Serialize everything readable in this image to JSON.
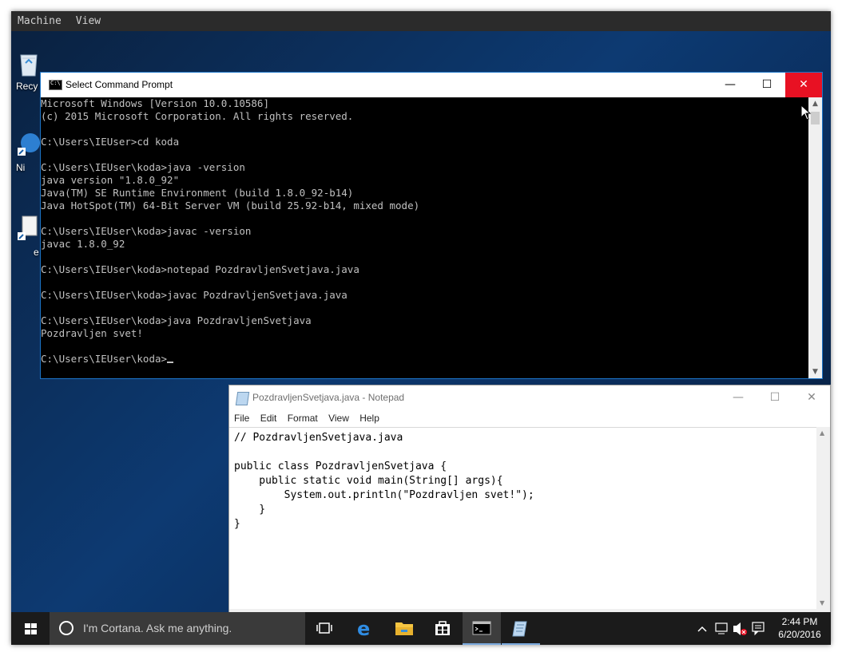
{
  "host": {
    "menu": [
      "Machine",
      "View"
    ]
  },
  "desktop_icons": [
    {
      "name": "recycle-bin",
      "label": "Recy"
    },
    {
      "name": "ni",
      "label": "Ni"
    },
    {
      "name": "e",
      "label": "e"
    }
  ],
  "cmd": {
    "title": "Select Command Prompt",
    "lines": [
      "Microsoft Windows [Version 10.0.10586]",
      "(c) 2015 Microsoft Corporation. All rights reserved.",
      "",
      "C:\\Users\\IEUser>cd koda",
      "",
      "C:\\Users\\IEUser\\koda>java -version",
      "java version \"1.8.0_92\"",
      "Java(TM) SE Runtime Environment (build 1.8.0_92-b14)",
      "Java HotSpot(TM) 64-Bit Server VM (build 25.92-b14, mixed mode)",
      "",
      "C:\\Users\\IEUser\\koda>javac -version",
      "javac 1.8.0_92",
      "",
      "C:\\Users\\IEUser\\koda>notepad PozdravljenSvetjava.java",
      "",
      "C:\\Users\\IEUser\\koda>javac PozdravljenSvetjava.java",
      "",
      "C:\\Users\\IEUser\\koda>java PozdravljenSvetjava",
      "Pozdravljen svet!",
      ""
    ],
    "prompt": "C:\\Users\\IEUser\\koda>"
  },
  "notepad": {
    "title": "PozdravljenSvetjava.java - Notepad",
    "menu": [
      "File",
      "Edit",
      "Format",
      "View",
      "Help"
    ],
    "lines": [
      "// PozdravljenSvetjava.java",
      "",
      "public class PozdravljenSvetjava {",
      "    public static void main(String[] args){",
      "        System.out.println(\"Pozdravljen svet!\");",
      "    }",
      "}"
    ]
  },
  "taskbar": {
    "search_placeholder": "I'm Cortana. Ask me anything.",
    "time": "2:44 PM",
    "date": "6/20/2016"
  },
  "colors": {
    "close_red": "#e81123",
    "taskbar": "#1b1b1b",
    "cmd_fg": "#c0c0c0"
  }
}
